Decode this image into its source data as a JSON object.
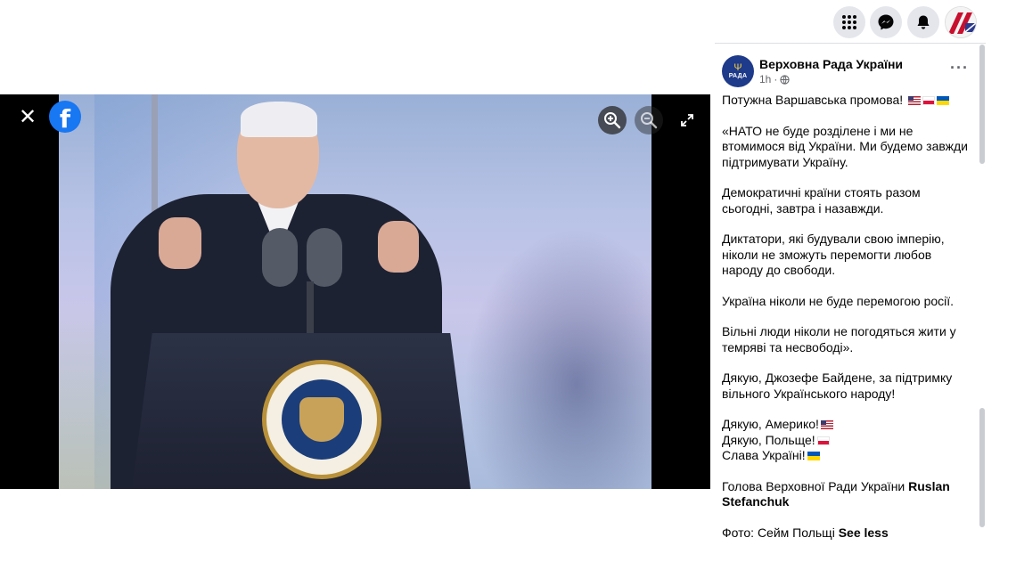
{
  "viewer": {
    "close_label": "✕",
    "fb_logo": "f",
    "icons": [
      "close-icon",
      "facebook-logo-icon",
      "zoom-in-icon",
      "zoom-out-icon",
      "fullscreen-icon"
    ]
  },
  "topbar": {
    "icons": [
      "menu-grid-icon",
      "messenger-icon",
      "notifications-bell-icon",
      "profile-avatar"
    ]
  },
  "post": {
    "author": "Верховна Рада України",
    "avatar_text": "РАДА",
    "time": "1h",
    "time_sep": "·",
    "more_label": "···",
    "lines": {
      "l1": "Потужна Варшавська промова!",
      "l2": "«НАТО не буде розділене і ми не втомимося від України. Ми будемо завжди підтримувати Україну.",
      "l3": "Демократичні країни стоять разом сьогодні, завтра і назавжди.",
      "l4": "Диктатори, які будували свою імперію, ніколи не зможуть перемогти любов народу до свободи.",
      "l5": "Україна ніколи не буде перемогою росії.",
      "l6": "Вільні люди ніколи не погодяться жити у темряві та несвободі».",
      "l7": "Дякую, Джозефе Байдене, за підтримку вільного Українського народу!",
      "l8": "Дякую, Америко!",
      "l9": "Дякую, Польще!",
      "l10": "Слава Україні!",
      "l11_prefix": "Голова Верховної Ради України ",
      "l11_name": "Ruslan Stefanchuk",
      "l12_prefix": "Фото: Сейм Польщі ",
      "see_less": "See less"
    }
  },
  "colors": {
    "brand_blue": "#1877f2",
    "text": "#050505",
    "secondary": "#65676b",
    "button_bg": "#e4e6eb"
  }
}
